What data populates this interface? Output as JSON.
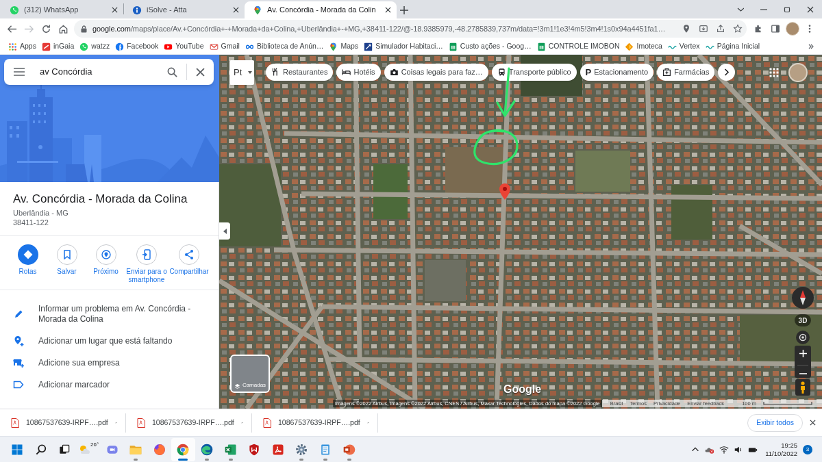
{
  "browser": {
    "tabs": [
      {
        "title": "(312) WhatsApp",
        "selected": false
      },
      {
        "title": "iSolve - Atta",
        "selected": false
      },
      {
        "title": "Av. Concórdia - Morada da Colin",
        "selected": true
      }
    ],
    "toolbar": {
      "forward_disabled": true,
      "url_host": "google.com",
      "url_path": "/maps/place/Av.+Concórdia+-+Morada+da+Colina,+Uberlândia+-+MG,+38411-122/@-18.9385979,-48.2785839,737m/data=!3m1!1e3!4m5!3m4!1s0x94a4451fa1…"
    },
    "bookmarks": [
      "Apps",
      "inGaia",
      "watzz",
      "Facebook",
      "YouTube",
      "Gmail",
      "Biblioteca de Anún…",
      "Maps",
      "Simulador Habitaci…",
      "Custo ações - Goog…",
      "CONTROLE IMOBON",
      "Imoteca",
      "Vertex",
      "Página Inicial"
    ]
  },
  "side_panel": {
    "search": {
      "value": "av Concórdia"
    },
    "place": {
      "title": "Av. Concórdia - Morada da Colina",
      "locality": "Uberlândia - MG",
      "postal_code": "38411-122"
    },
    "actions": [
      {
        "label": "Rotas",
        "primary": true
      },
      {
        "label": "Salvar",
        "primary": false
      },
      {
        "label": "Próximo",
        "primary": false
      },
      {
        "label": "Enviar para o smartphone",
        "primary": false
      },
      {
        "label": "Compartilhar",
        "primary": false
      }
    ],
    "links": [
      "Informar um problema em Av. Concórdia - Morada da Colina",
      "Adicionar um lugar que está faltando",
      "Adicione sua empresa",
      "Adicionar marcador"
    ]
  },
  "map": {
    "input_tool": "Pt",
    "chips": [
      {
        "label": "Restaurantes"
      },
      {
        "label": "Hotéis"
      },
      {
        "label": "Coisas legais para faz…"
      },
      {
        "label": "Transporte público"
      },
      {
        "label": "Estacionamento",
        "symbol": "P"
      },
      {
        "label": "Farmácias"
      }
    ],
    "tilt": "3D",
    "layers": "Camadas",
    "logo": "Google",
    "attribution": "Imagens ©2022 Airbus, Imagens ©2022 Airbus, CNES / Airbus, Maxar Technologies, Dados do mapa ©2022 Google",
    "footer_links": [
      "Brasil",
      "Termos",
      "Privacidade",
      "Enviar feedback"
    ],
    "scale": "100 m"
  },
  "downloads": {
    "items": [
      "10867537639-IRPF….pdf",
      "10867537639-IRPF….pdf",
      "10867537639-IRPF….pdf"
    ],
    "show_all": "Exibir todos"
  },
  "taskbar": {
    "weather_temp": "26°",
    "apps": [
      {
        "running": false,
        "selected": false
      },
      {
        "running": true,
        "selected": false
      },
      {
        "running": false,
        "selected": false
      },
      {
        "running": true,
        "selected": true
      },
      {
        "running": true,
        "selected": false
      },
      {
        "running": true,
        "selected": false
      },
      {
        "running": false,
        "selected": false
      },
      {
        "running": false,
        "selected": false
      },
      {
        "running": true,
        "selected": false
      },
      {
        "running": true,
        "selected": false
      },
      {
        "running": true,
        "selected": false
      }
    ],
    "clock": {
      "time": "19:25",
      "date": "11/10/2022"
    },
    "notifications": "3"
  }
}
